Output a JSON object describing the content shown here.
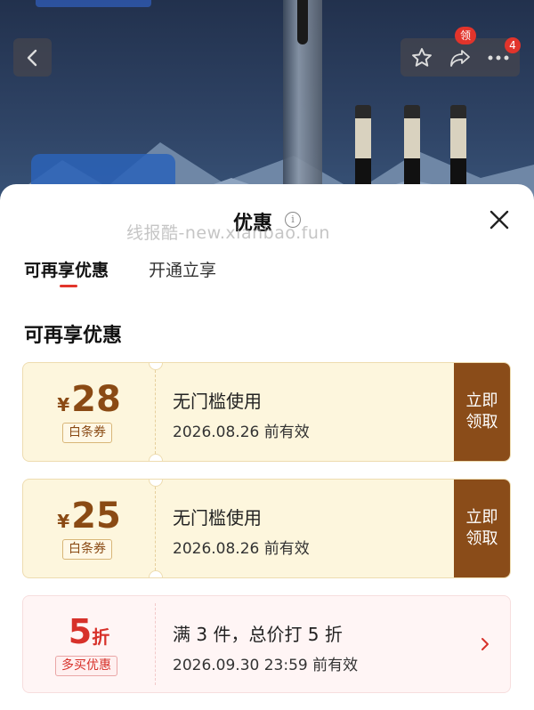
{
  "header": {
    "favorite_icon": "star-icon",
    "share_icon": "share-icon",
    "more_icon": "more-icon",
    "share_badge": "领",
    "more_badge": "4"
  },
  "sheet": {
    "title": "优惠",
    "info_icon": "i",
    "watermark": "线报酷-new.xianbao.fun"
  },
  "tabs": [
    {
      "label": "可再享优惠",
      "active": true
    },
    {
      "label": "开通立享",
      "active": false
    }
  ],
  "section_title": "可再享优惠",
  "coupons": [
    {
      "currency": "¥",
      "amount": "28",
      "tag": "白条券",
      "title": "无门槛使用",
      "expiry": "2026.08.26 前有效",
      "action_line1": "立即",
      "action_line2": "领取"
    },
    {
      "currency": "¥",
      "amount": "25",
      "tag": "白条券",
      "title": "无门槛使用",
      "expiry": "2026.08.26 前有效",
      "action_line1": "立即",
      "action_line2": "领取"
    },
    {
      "amount": "5",
      "unit": "折",
      "tag": "多买优惠",
      "title": "满 3 件，总价打 5 折",
      "expiry": "2026.09.30 23:59 前有效"
    }
  ],
  "colors": {
    "accent_red": "#e2342b",
    "coupon_brown": "#8a4c19",
    "coupon_bg": "#fdf6dd",
    "discount_red": "#d7312a"
  }
}
